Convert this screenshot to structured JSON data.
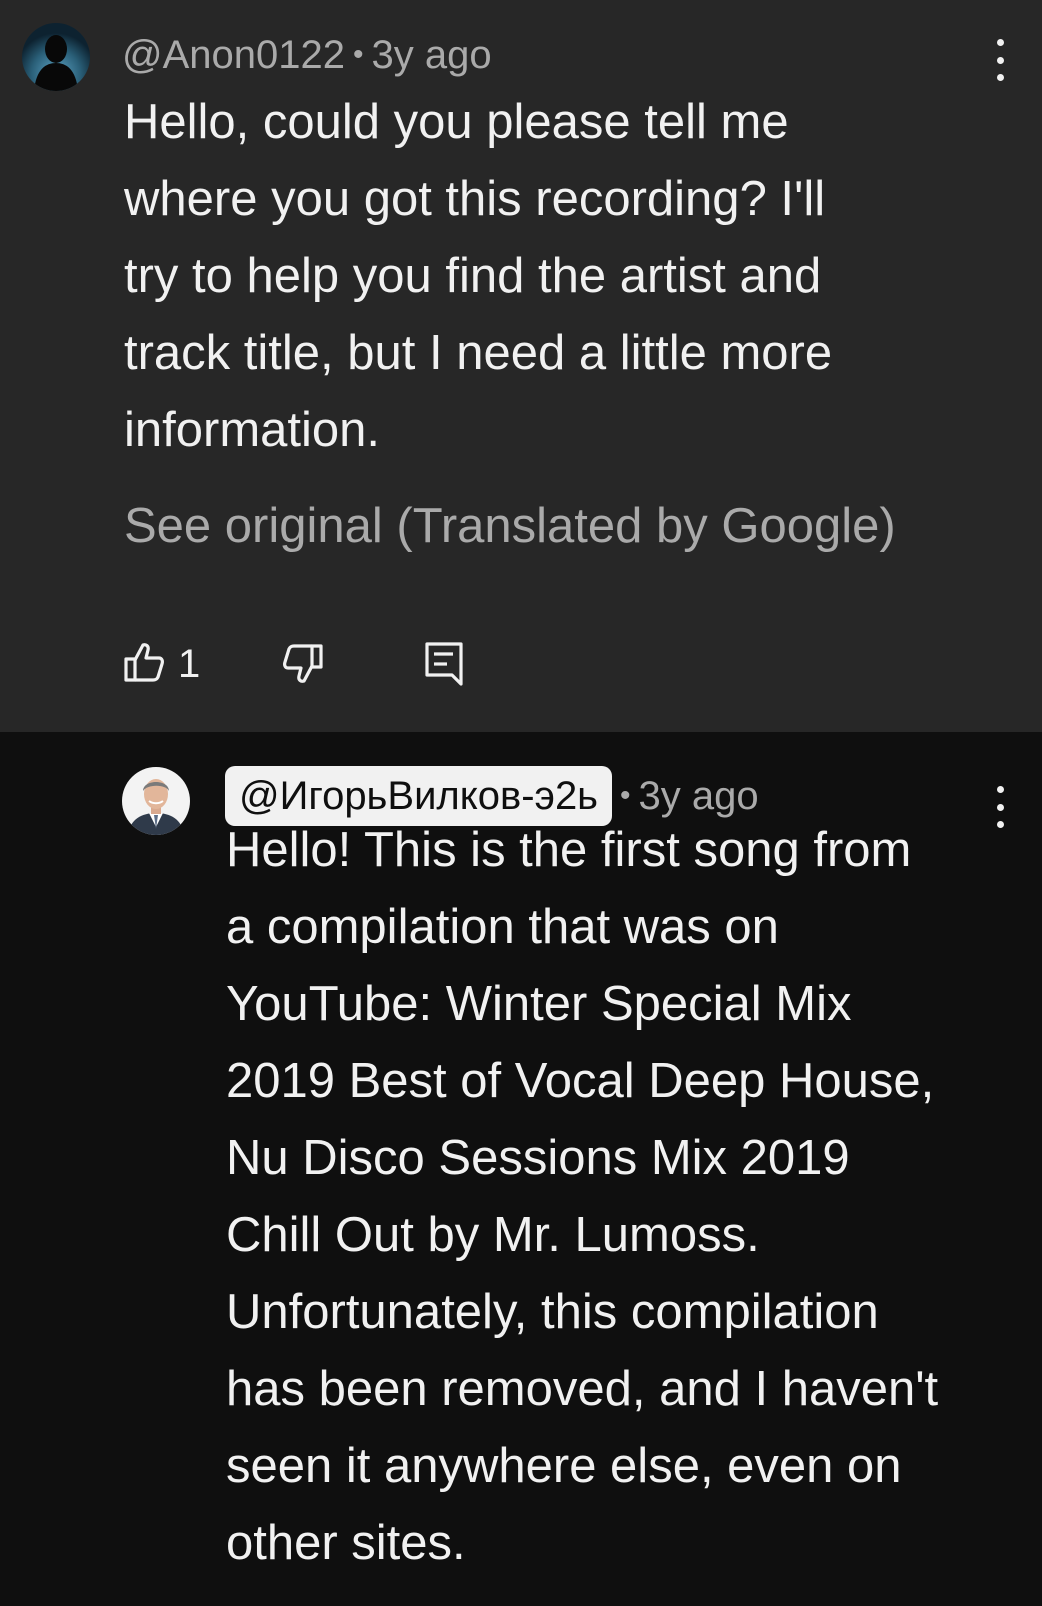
{
  "parent_comment": {
    "handle": "@Anon0122",
    "separator": "•",
    "time": "3y ago",
    "text_lines": [
      "Hello, could you please tell me",
      "where you got this recording? I'll",
      "try to help you find the artist and",
      "track title, but I need a little more",
      "information."
    ],
    "see_original": "See original (Translated by Google)",
    "like_count": "1",
    "icons": {
      "like": "thumbs-up-icon",
      "dislike": "thumbs-down-icon",
      "reply": "reply-comment-icon",
      "menu": "more-vert-icon"
    }
  },
  "reply_comment": {
    "handle": "@ИгорьВилков-э2ь",
    "separator": "•",
    "time": "3y ago",
    "text_lines": [
      "Hello! This is the first song from",
      "a compilation that was on",
      "YouTube: Winter Special Mix",
      "2019 Best of Vocal Deep House,",
      "Nu Disco Sessions Mix 2019",
      "Chill Out by Mr. Lumoss.",
      "Unfortunately, this compilation",
      "has been removed, and I haven't",
      "seen it anywhere else, even on",
      "other sites."
    ],
    "icons": {
      "menu": "more-vert-icon"
    }
  },
  "colors": {
    "parent_bg": "#272727",
    "reply_bg": "#0f0f0f",
    "primary_text": "#f1f1f1",
    "secondary_text": "#aaaaaa"
  }
}
